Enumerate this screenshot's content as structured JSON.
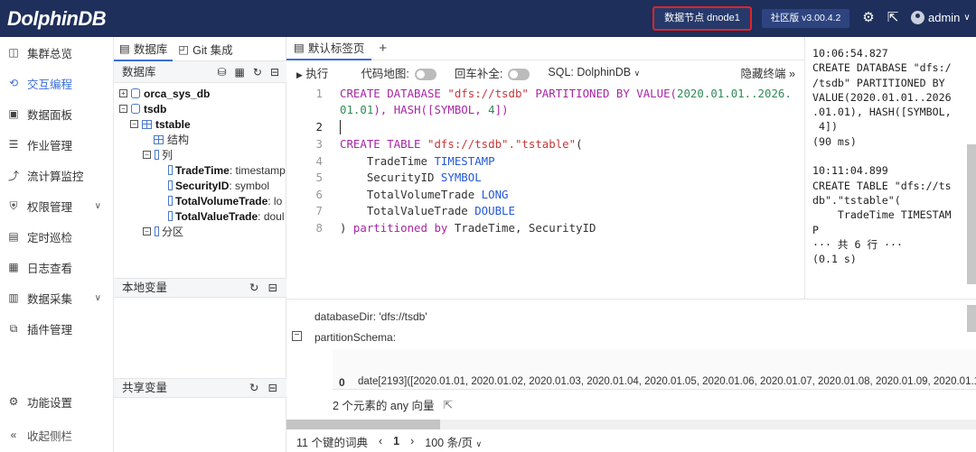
{
  "topbar": {
    "logo_text": "DolphinDB",
    "node_label": "数据节点 dnode1",
    "version_label": "社区版 v3.00.4.2",
    "user": "admin",
    "icons": [
      "gear-icon",
      "export-icon",
      "user-avatar-icon"
    ]
  },
  "sidebar": {
    "items": [
      {
        "label": "集群总览",
        "icon": "cluster-icon"
      },
      {
        "label": "交互编程",
        "icon": "code-icon",
        "active": true
      },
      {
        "label": "数据面板",
        "icon": "dashboard-icon"
      },
      {
        "label": "作业管理",
        "icon": "job-icon"
      },
      {
        "label": "流计算监控",
        "icon": "stream-icon"
      },
      {
        "label": "权限管理",
        "icon": "permission-icon",
        "has_submenu": true
      },
      {
        "label": "定时巡检",
        "icon": "inspection-icon"
      },
      {
        "label": "日志查看",
        "icon": "log-icon"
      },
      {
        "label": "数据采集",
        "icon": "collection-icon",
        "has_submenu": true
      },
      {
        "label": "插件管理",
        "icon": "plugin-icon"
      }
    ],
    "settings_label": "功能设置",
    "collapse_label": "收起侧栏"
  },
  "dbpanel": {
    "tabs": [
      "数据库",
      "Git 集成"
    ],
    "header": "数据库",
    "tree": {
      "db1": "orca_sys_db",
      "db2": "tsdb",
      "table": "tstable",
      "schema": "结构",
      "columns": "列",
      "cols": [
        {
          "name": "TradeTime",
          "type": ": timestamp"
        },
        {
          "name": "SecurityID",
          "type": ": symbol"
        },
        {
          "name": "TotalVolumeTrade",
          "type": ": lo"
        },
        {
          "name": "TotalValueTrade",
          "type": ": doul"
        }
      ],
      "partitions": "分区"
    },
    "local_vars": "本地变量",
    "shared_vars": "共享变量"
  },
  "editor": {
    "tab_label": "默认标签页",
    "run_label": "执行",
    "minimap_label": "代码地图:",
    "enter_complete_label": "回车补全:",
    "sql_label": "SQL:",
    "sql_value": "DolphinDB",
    "hide_terminal": "隐藏终端",
    "line_numbers": [
      "1",
      "2",
      "3",
      "4",
      "5",
      "6",
      "7",
      "8"
    ],
    "code": {
      "l1a_kw": "CREATE DATABASE ",
      "l1a_str": "\"dfs://tsdb\"",
      "l1a_kw2": " PARTITIONED BY VALUE(",
      "l1a_num": "2020.01.01..2026.",
      "l1b_num": "01.01",
      "l1b_rest": "), HASH([SYMBOL, ",
      "l1b_n4": "4",
      "l1b_end": "])",
      "l3_kw": "CREATE TABLE ",
      "l3_str": "\"dfs://tsdb\".\"tstable\"",
      "l3_end": "(",
      "l4_name": "    TradeTime ",
      "l4_type": "TIMESTAMP",
      "l5_name": "    SecurityID ",
      "l5_type": "SYMBOL",
      "l6_name": "    TotalVolumeTrade ",
      "l6_type": "LONG",
      "l7_name": "    TotalValueTrade ",
      "l7_type": "DOUBLE",
      "l8_a": ") ",
      "l8_kw": "partitioned by",
      "l8_rest": " TradeTime, SecurityID"
    }
  },
  "log": {
    "text": "10:06:54.827\nCREATE DATABASE \"dfs:/\n/tsdb\" PARTITIONED BY\nVALUE(2020.01.01..2026\n.01.01), HASH([SYMBOL,\n 4])\n(90 ms)\n\n10:11:04.899\nCREATE TABLE \"dfs://ts\ndb\".\"tstable\"(\n    TradeTime TIMESTAM\nP\n··· 共 6 行 ···\n(0.1 s)"
  },
  "result": {
    "database_dir": "databaseDir: 'dfs://tsdb'",
    "partition_schema": "partitionSchema:",
    "row_index": "0",
    "row_value": "date[2193]([2020.01.01, 2020.01.02, 2020.01.03, 2020.01.04, 2020.01.05, 2020.01.06, 2020.01.07, 2020.01.08, 2020.01.09, 2020.01.10",
    "vector_summary": "2 个元素的 any 向量",
    "dict_summary": "11 个键的词典",
    "page": "1",
    "page_size": "100 条/页"
  }
}
